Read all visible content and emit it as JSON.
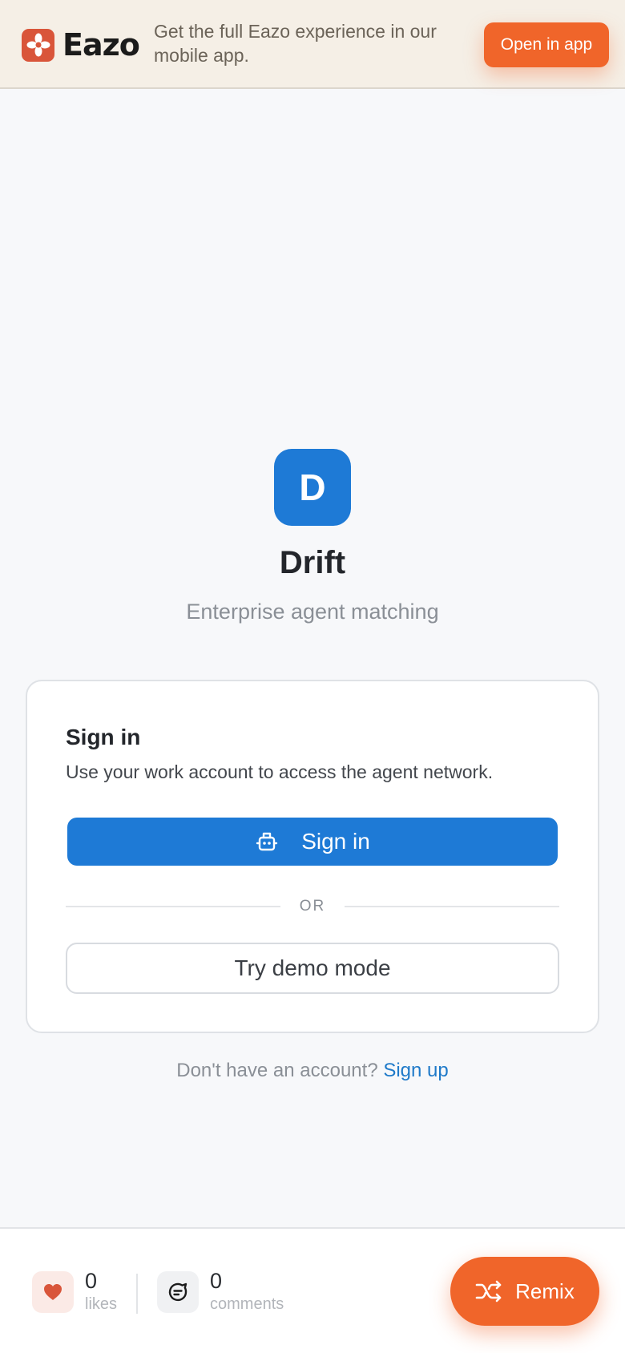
{
  "banner": {
    "brand_name": "Eazo",
    "text": "Get the full Eazo experience in our mobile app.",
    "open_label": "Open in app"
  },
  "app": {
    "logo_letter": "D",
    "name": "Drift",
    "tagline": "Enterprise agent matching"
  },
  "signin_card": {
    "title": "Sign in",
    "subtitle": "Use your work account to access the agent network.",
    "signin_label": "Sign in",
    "divider_text": "OR",
    "demo_label": "Try demo mode"
  },
  "signup": {
    "prompt": "Don't have an account?",
    "link": "Sign up"
  },
  "bottom_bar": {
    "likes_count": "0",
    "likes_label": "likes",
    "comments_count": "0",
    "comments_label": "comments",
    "remix_label": "Remix"
  },
  "colors": {
    "accent": "#f0652a",
    "primary": "#1e7ad6",
    "brand": "#d9553a",
    "banner_bg": "#f5efe6"
  },
  "icons": [
    "eazo-logo-icon",
    "robot-icon",
    "heart-icon",
    "comment-icon",
    "shuffle-icon"
  ]
}
